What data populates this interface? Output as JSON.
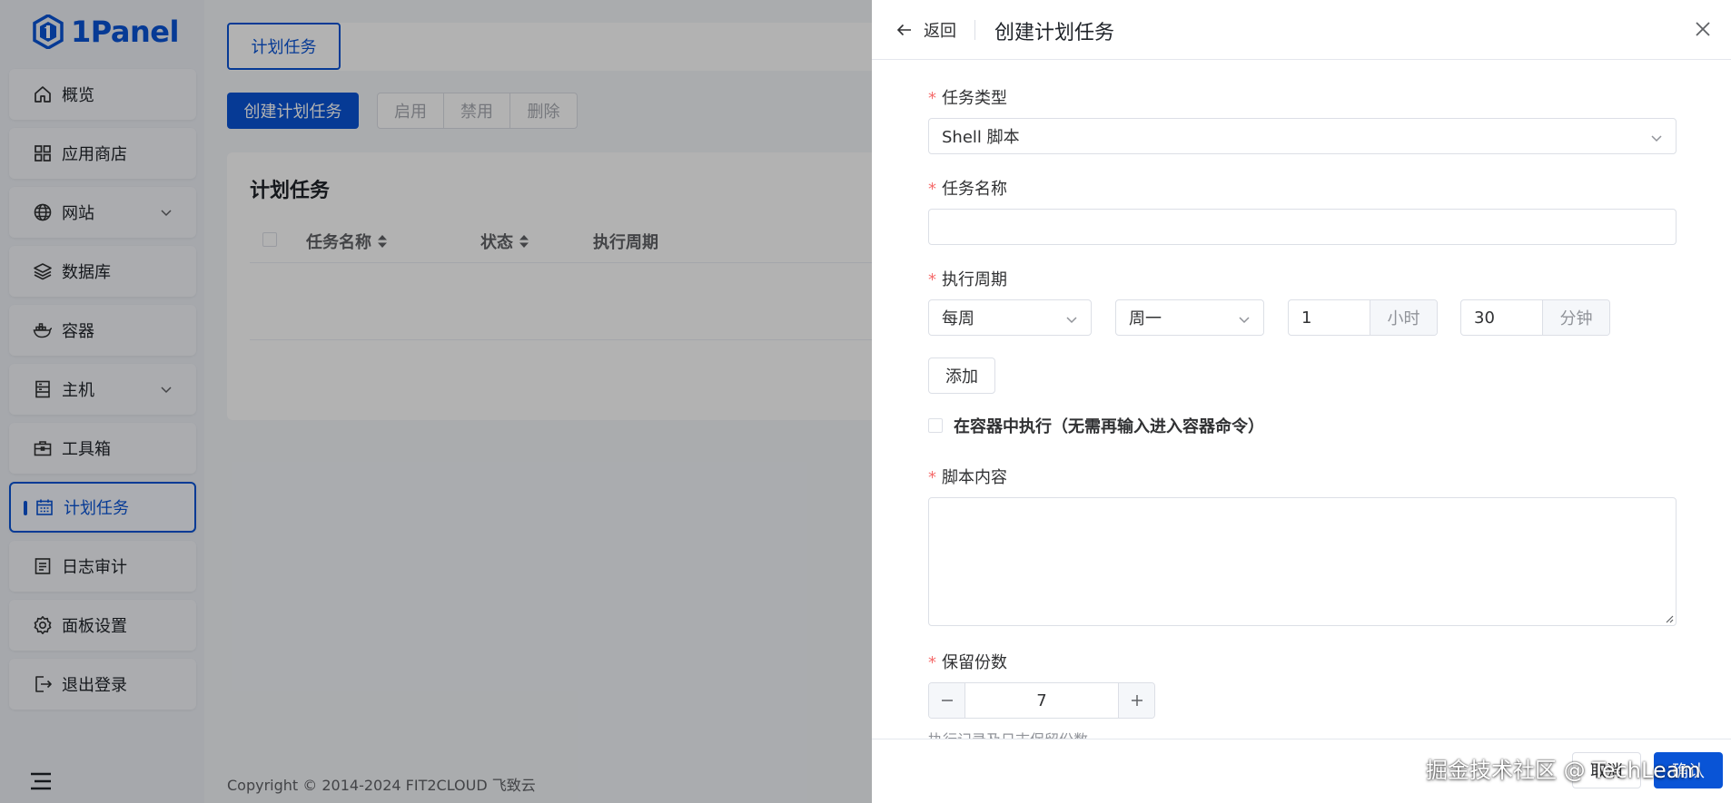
{
  "brand": {
    "name": "1Panel",
    "color": "#0954d6"
  },
  "sidebar": {
    "items": [
      {
        "label": "概览",
        "icon": "home-icon",
        "has_children": false,
        "active": false
      },
      {
        "label": "应用商店",
        "icon": "grid-icon",
        "has_children": false,
        "active": false
      },
      {
        "label": "网站",
        "icon": "globe-icon",
        "has_children": true,
        "active": false
      },
      {
        "label": "数据库",
        "icon": "layers-icon",
        "has_children": false,
        "active": false
      },
      {
        "label": "容器",
        "icon": "docker-icon",
        "has_children": false,
        "active": false
      },
      {
        "label": "主机",
        "icon": "server-icon",
        "has_children": true,
        "active": false
      },
      {
        "label": "工具箱",
        "icon": "toolbox-icon",
        "has_children": false,
        "active": false
      },
      {
        "label": "计划任务",
        "icon": "calendar-icon",
        "has_children": false,
        "active": true
      },
      {
        "label": "日志审计",
        "icon": "log-icon",
        "has_children": false,
        "active": false
      },
      {
        "label": "面板设置",
        "icon": "gear-icon",
        "has_children": false,
        "active": false
      },
      {
        "label": "退出登录",
        "icon": "logout-icon",
        "has_children": false,
        "active": false
      }
    ]
  },
  "main": {
    "tab_label": "计划任务",
    "toolbar": {
      "create_label": "创建计划任务",
      "enable_label": "启用",
      "disable_label": "禁用",
      "delete_label": "删除"
    },
    "card_title": "计划任务",
    "columns": [
      "任务名称",
      "状态",
      "执行周期"
    ],
    "footer": "Copyright © 2014-2024 FIT2CLOUD 飞致云"
  },
  "drawer": {
    "back_label": "返回",
    "title": "创建计划任务",
    "fields": {
      "task_type": {
        "label": "任务类型",
        "value": "Shell 脚本"
      },
      "task_name": {
        "label": "任务名称",
        "value": ""
      },
      "cycle": {
        "label": "执行周期",
        "period": "每周",
        "weekday": "周一",
        "hour": "1",
        "hour_unit": "小时",
        "minute": "30",
        "minute_unit": "分钟",
        "add_label": "添加"
      },
      "in_container": {
        "label": "在容器中执行（无需再输入进入容器命令）",
        "checked": false
      },
      "script": {
        "label": "脚本内容",
        "value": ""
      },
      "retain": {
        "label": "保留份数",
        "value": "7",
        "hint": "执行记录及日志保留份数"
      }
    },
    "footer": {
      "cancel_label": "取消",
      "confirm_label": "确认"
    }
  },
  "watermark": "掘金技术社区 @ TechLeam"
}
